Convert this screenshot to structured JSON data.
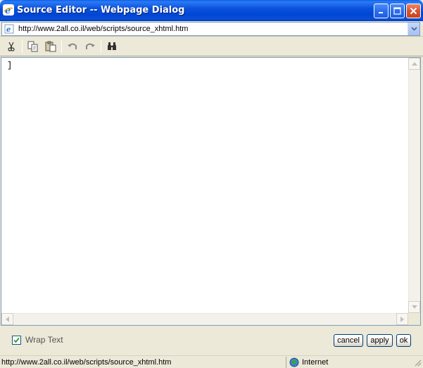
{
  "window": {
    "title": "Source Editor -- Webpage Dialog",
    "title_icon": "ie-icon",
    "controls": [
      "minimize-icon",
      "maximize-icon",
      "close-icon"
    ]
  },
  "address": {
    "url": "http://www.2all.co.il/web/scripts/source_xhtml.htm",
    "icon": "ie-page-icon"
  },
  "toolbar": {
    "tools": [
      "cut-icon",
      "copy-icon",
      "paste-icon",
      "undo-icon",
      "redo-icon",
      "find-icon"
    ]
  },
  "editor": {
    "content": "]"
  },
  "options": {
    "wrap_text_label": "Wrap Text",
    "wrap_text_checked": true,
    "cancel_label": "cancel",
    "apply_label": "apply",
    "ok_label": "ok"
  },
  "status": {
    "url": "http://www.2all.co.il/web/scripts/source_xhtml.htm",
    "zone": "Internet"
  },
  "colors": {
    "title_bar": "#0a52dc",
    "dialog_bg": "#ece9d8",
    "editor_bg": "#ffffff"
  }
}
